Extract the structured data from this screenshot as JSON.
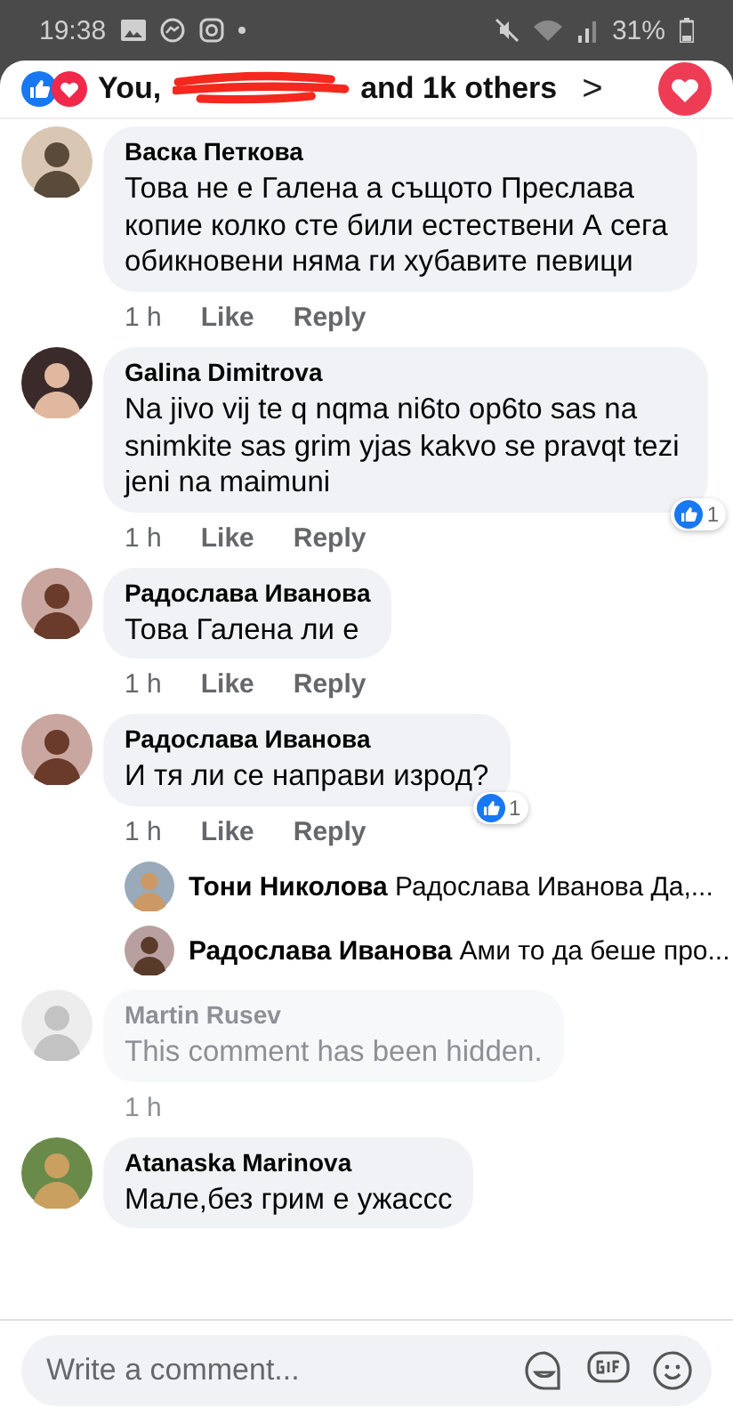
{
  "status_bar": {
    "time": "19:38",
    "battery": "31%"
  },
  "header": {
    "names_start": "You,",
    "names_end": "and 1k others",
    "chevron": ">"
  },
  "comments": [
    {
      "kind": "comment",
      "name": "Васка Петкова",
      "text": "Това не е Галена а същото Преслава копие колко сте били естествени А сега обикновени няма ги хубавите певици",
      "time": "1 h",
      "actions": [
        "Like",
        "Reply"
      ]
    },
    {
      "kind": "comment",
      "name": "Galina Dimitrova",
      "text": "Na jivo vij te q nqma ni6to op6to sas na snimkite sas grim yjas kakvo se pravqt tezi jeni na maimuni",
      "time": "1 h",
      "actions": [
        "Like",
        "Reply"
      ],
      "reactions": "1"
    },
    {
      "kind": "comment",
      "name": "Радослава Иванова",
      "text": "Това Галена ли е",
      "time": "1 h",
      "actions": [
        "Like",
        "Reply"
      ]
    },
    {
      "kind": "comment",
      "name": "Радослава Иванова",
      "text": "И тя ли се направи изрод?",
      "time": "1 h",
      "actions": [
        "Like",
        "Reply"
      ],
      "reactions": "1"
    },
    {
      "kind": "reply",
      "name": "Тони Николова",
      "text": "Радослава Иванова Да,..."
    },
    {
      "kind": "reply",
      "name": "Радослава Иванова",
      "text": "Ами то да беше про..."
    },
    {
      "kind": "hidden",
      "name": "Martin Rusev",
      "text": "This comment has been hidden.",
      "time": "1 h"
    },
    {
      "kind": "comment",
      "name": "Atanaska Marinova",
      "text": "Мале,без грим е ужассс"
    }
  ],
  "composer": {
    "placeholder": "Write a comment..."
  }
}
